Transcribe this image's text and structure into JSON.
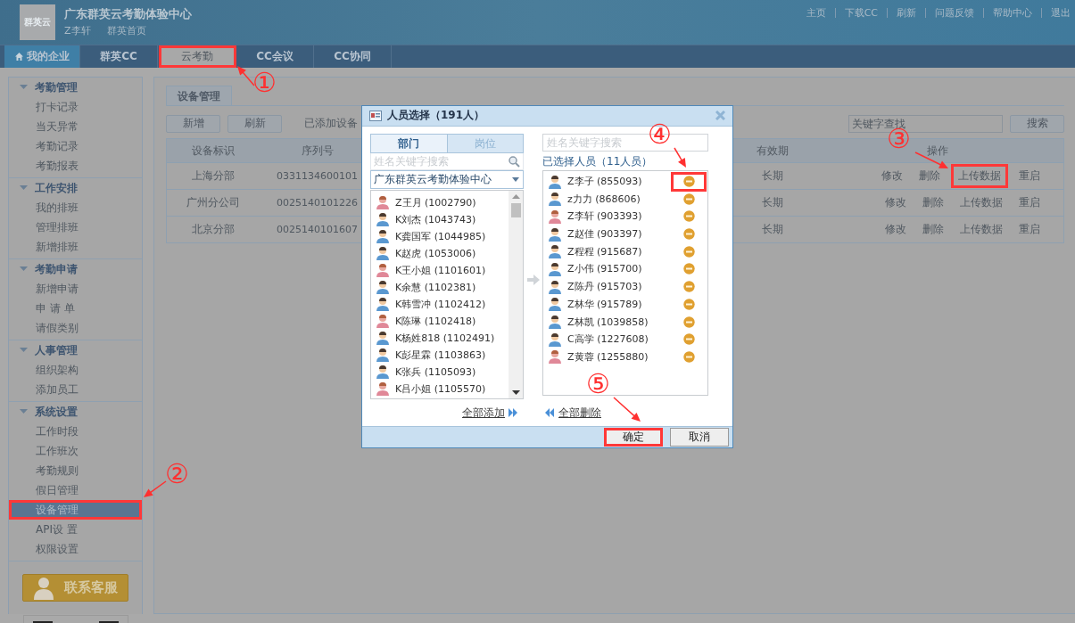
{
  "header": {
    "logo": "群英云",
    "title": "广东群英云考勤体验中心",
    "user": "Z李轩",
    "home_link": "群英首页",
    "links": [
      "主页",
      "下载CC",
      "刷新",
      "问题反馈",
      "帮助中心",
      "退出"
    ]
  },
  "nav_tabs": [
    {
      "label": "我的企业",
      "kind": "home",
      "selected": false,
      "highlighted": false
    },
    {
      "label": "群英CC",
      "kind": "plain",
      "selected": false,
      "highlighted": false
    },
    {
      "label": "云考勤",
      "kind": "plain",
      "selected": true,
      "highlighted": true
    },
    {
      "label": "CC会议",
      "kind": "plain",
      "selected": false,
      "highlighted": false
    },
    {
      "label": "CC协同",
      "kind": "plain",
      "selected": false,
      "highlighted": false
    }
  ],
  "sidebar": {
    "groups": [
      {
        "title": "考勤管理",
        "expanded": true,
        "items": [
          {
            "label": "打卡记录",
            "selected": false,
            "highlighted": false
          },
          {
            "label": "当天异常",
            "selected": false,
            "highlighted": false
          },
          {
            "label": "考勤记录",
            "selected": false,
            "highlighted": false
          },
          {
            "label": "考勤报表",
            "selected": false,
            "highlighted": false
          }
        ]
      },
      {
        "title": "工作安排",
        "expanded": true,
        "items": [
          {
            "label": "我的排班",
            "selected": false,
            "highlighted": false
          },
          {
            "label": "管理排班",
            "selected": false,
            "highlighted": false
          },
          {
            "label": "新增排班",
            "selected": false,
            "highlighted": false
          }
        ]
      },
      {
        "title": "考勤申请",
        "expanded": true,
        "items": [
          {
            "label": "新增申请",
            "selected": false,
            "highlighted": false
          },
          {
            "label": "申 请 单",
            "selected": false,
            "highlighted": false
          },
          {
            "label": "请假类别",
            "selected": false,
            "highlighted": false
          }
        ]
      },
      {
        "title": "人事管理",
        "expanded": true,
        "items": [
          {
            "label": "组织架构",
            "selected": false,
            "highlighted": false
          },
          {
            "label": "添加员工",
            "selected": false,
            "highlighted": false
          }
        ]
      },
      {
        "title": "系统设置",
        "expanded": true,
        "items": [
          {
            "label": "工作时段",
            "selected": false,
            "highlighted": false
          },
          {
            "label": "工作班次",
            "selected": false,
            "highlighted": false
          },
          {
            "label": "考勤规则",
            "selected": false,
            "highlighted": false
          },
          {
            "label": "假日管理",
            "selected": false,
            "highlighted": false
          },
          {
            "label": "设备管理",
            "selected": true,
            "highlighted": true
          },
          {
            "label": "API设 置",
            "selected": false,
            "highlighted": false
          },
          {
            "label": "权限设置",
            "selected": false,
            "highlighted": false
          }
        ]
      }
    ],
    "contact_button": "联系客服"
  },
  "content": {
    "tab": "设备管理",
    "buttons": [
      "新增",
      "刷新"
    ],
    "added_label": "已添加设备",
    "search": {
      "placeholder": "关键字查找"
    },
    "search_button": "搜索",
    "table": {
      "columns": [
        "设备标识",
        "序列号",
        "有效期",
        "操作"
      ],
      "rows": [
        {
          "name": "上海分部",
          "serial": "0331134600101",
          "validity": "长期",
          "actions": [
            {
              "label": "修改",
              "highlighted": false
            },
            {
              "label": "删除",
              "highlighted": false
            },
            {
              "label": "上传数据",
              "highlighted": true
            },
            {
              "label": "重启",
              "highlighted": false
            }
          ]
        },
        {
          "name": "广州分公司",
          "serial": "0025140101226",
          "validity": "长期",
          "actions": [
            {
              "label": "修改",
              "highlighted": false
            },
            {
              "label": "删除",
              "highlighted": false
            },
            {
              "label": "上传数据",
              "highlighted": false
            },
            {
              "label": "重启",
              "highlighted": false
            }
          ]
        },
        {
          "name": "北京分部",
          "serial": "0025140101607",
          "validity": "长期",
          "actions": [
            {
              "label": "修改",
              "highlighted": false
            },
            {
              "label": "删除",
              "highlighted": false
            },
            {
              "label": "上传数据",
              "highlighted": false
            },
            {
              "label": "重启",
              "highlighted": false
            }
          ]
        }
      ]
    }
  },
  "dialog": {
    "title": "人员选择（191人）",
    "tabs": [
      {
        "label": "部门",
        "selected": true
      },
      {
        "label": "岗位",
        "selected": false
      }
    ],
    "left_search": {
      "placeholder": "姓名关键字搜索"
    },
    "department": "广东群英云考勤体验中心",
    "people": [
      {
        "name": "Z王月 (1002790)",
        "kind": "female"
      },
      {
        "name": "K刘杰 (1043743)",
        "kind": "male"
      },
      {
        "name": "K龚国军 (1044985)",
        "kind": "male"
      },
      {
        "name": "K赵虎 (1053006)",
        "kind": "male"
      },
      {
        "name": "K王小姐 (1101601)",
        "kind": "female"
      },
      {
        "name": "K余慧 (1102381)",
        "kind": "male"
      },
      {
        "name": "K韩雪冲 (1102412)",
        "kind": "male"
      },
      {
        "name": "K陈琳 (1102418)",
        "kind": "female"
      },
      {
        "name": "K杨姓818 (1102491)",
        "kind": "male"
      },
      {
        "name": "K彭星霖 (1103863)",
        "kind": "male"
      },
      {
        "name": "K张兵 (1105093)",
        "kind": "male"
      },
      {
        "name": "K吕小姐 (1105570)",
        "kind": "female"
      }
    ],
    "right_search": {
      "placeholder": "姓名关键字搜索"
    },
    "selected_label": "已选择人员（11人员）",
    "selected_people": [
      {
        "name": "Z李子 (855093)",
        "kind": "male",
        "highlighted": true
      },
      {
        "name": "z力力 (868606)",
        "kind": "male",
        "highlighted": false
      },
      {
        "name": "Z李轩 (903393)",
        "kind": "female",
        "highlighted": false
      },
      {
        "name": "Z赵佳 (903397)",
        "kind": "male",
        "highlighted": false
      },
      {
        "name": "Z程程 (915687)",
        "kind": "male",
        "highlighted": false
      },
      {
        "name": "Z小伟 (915700)",
        "kind": "male",
        "highlighted": false
      },
      {
        "name": "Z陈丹 (915703)",
        "kind": "male",
        "highlighted": false
      },
      {
        "name": "Z林华 (915789)",
        "kind": "male",
        "highlighted": false
      },
      {
        "name": "Z林凯 (1039858)",
        "kind": "male",
        "highlighted": false
      },
      {
        "name": "C高学 (1227608)",
        "kind": "male",
        "highlighted": false
      },
      {
        "name": "Z黄蓉 (1255880)",
        "kind": "female",
        "highlighted": false
      }
    ],
    "add_all": "全部添加",
    "remove_all": "全部删除",
    "ok": {
      "label": "确定",
      "highlighted": true
    },
    "cancel": {
      "label": "取消",
      "highlighted": false
    }
  },
  "annotations": [
    {
      "label": "①"
    },
    {
      "label": "②"
    },
    {
      "label": "③"
    },
    {
      "label": "④"
    },
    {
      "label": "⑤"
    }
  ]
}
